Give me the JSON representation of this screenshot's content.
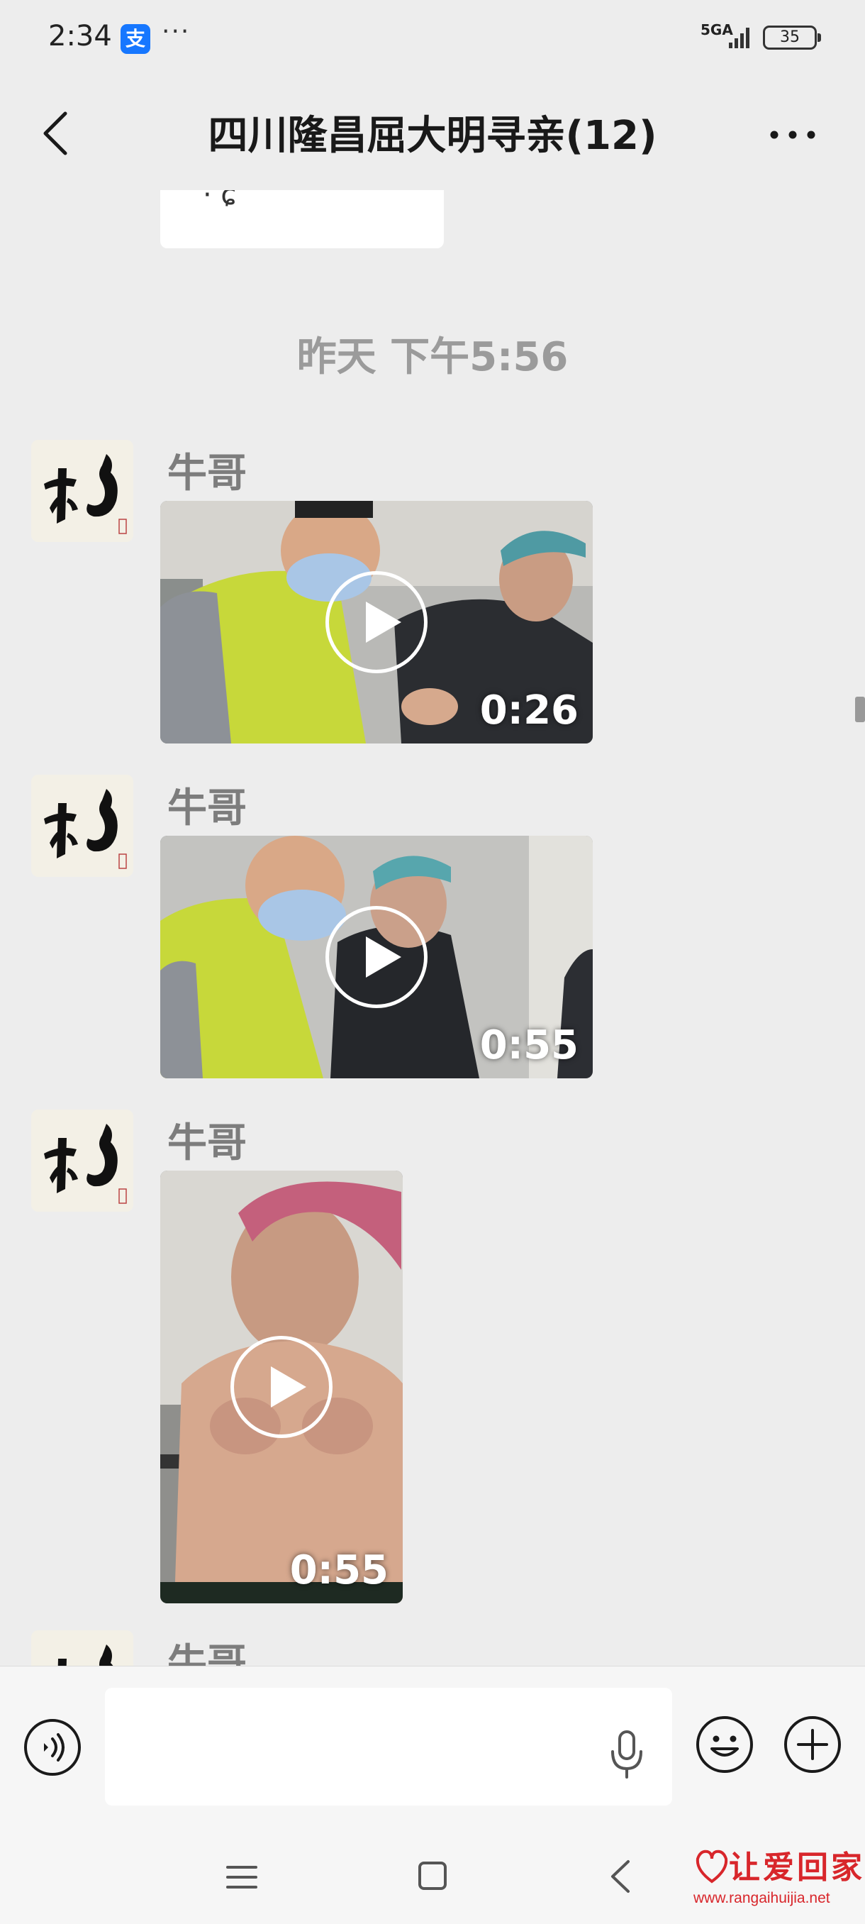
{
  "status_bar": {
    "time": "2:34",
    "app_badge": "支",
    "more": "···",
    "network": "5GA",
    "battery": "35"
  },
  "header": {
    "title": "四川隆昌屈大明寻亲(12)"
  },
  "chat": {
    "timestamp": "昨天 下午5:56",
    "messages": [
      {
        "sender": "牛哥",
        "type": "video",
        "duration": "0:26"
      },
      {
        "sender": "牛哥",
        "type": "video",
        "duration": "0:55"
      },
      {
        "sender": "牛哥",
        "type": "video",
        "duration": "0:55"
      },
      {
        "sender": "牛哥",
        "type": "partial"
      }
    ]
  },
  "input_bar": {
    "text_value": "",
    "icons": [
      "voice-icon",
      "microphone-icon",
      "emoji-icon",
      "plus-icon"
    ]
  },
  "system_nav": {
    "icons": [
      "menu-icon",
      "home-icon",
      "back-icon"
    ]
  },
  "watermark": {
    "logo": "让爱回家",
    "url": "www.rangaihuijia.net"
  },
  "colors": {
    "background": "#ededed",
    "bubble": "#ffffff",
    "alipay_blue": "#1677ff",
    "watermark_red": "#d8262b"
  }
}
